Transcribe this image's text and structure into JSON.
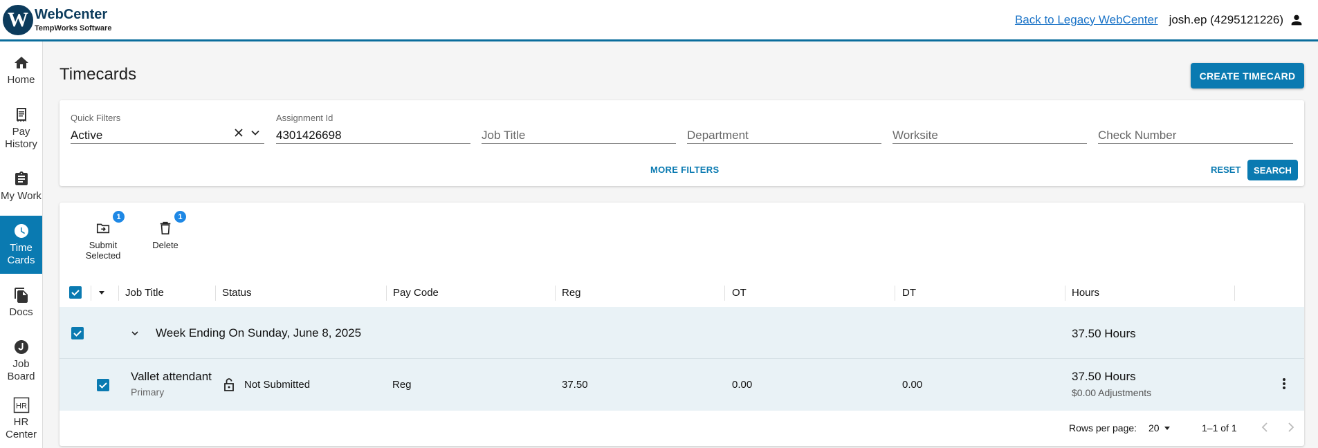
{
  "header": {
    "logo_letter": "W",
    "app_name": "WebCenter",
    "company": "TempWorks Software",
    "legacy_link": "Back to Legacy WebCenter",
    "user": "josh.ep (4295121226)"
  },
  "sidebar": {
    "items": [
      {
        "label": "Home",
        "icon": "home-icon"
      },
      {
        "label": "Pay History",
        "icon": "receipt-icon"
      },
      {
        "label": "My Work",
        "icon": "clipboard-icon"
      },
      {
        "label": "Time Cards",
        "icon": "clock-icon",
        "active": true
      },
      {
        "label": "Docs",
        "icon": "documents-icon"
      },
      {
        "label": "Job Board",
        "icon": "job-board-icon"
      },
      {
        "label": "HR Center",
        "icon": "hr-icon"
      }
    ]
  },
  "page": {
    "title": "Timecards",
    "create_button": "CREATE TIMECARD"
  },
  "filters": {
    "quick_filters_label": "Quick Filters",
    "quick_filters_value": "Active",
    "assignment_label": "Assignment Id",
    "assignment_value": "4301426698",
    "job_title_placeholder": "Job Title",
    "department_placeholder": "Department",
    "worksite_placeholder": "Worksite",
    "check_number_placeholder": "Check Number",
    "more_filters": "MORE FILTERS",
    "reset": "RESET",
    "search": "SEARCH"
  },
  "actions": {
    "submit_label": "Submit Selected",
    "submit_count": "1",
    "delete_label": "Delete",
    "delete_count": "1"
  },
  "table": {
    "columns": [
      "Job Title",
      "Status",
      "Pay Code",
      "Reg",
      "OT",
      "DT",
      "Hours"
    ],
    "group": {
      "title": "Week Ending On Sunday, June 8, 2025",
      "hours": "37.50 Hours"
    },
    "row": {
      "job_title": "Vallet attendant",
      "job_subtitle": "Primary",
      "status": "Not Submitted",
      "pay_code": "Reg",
      "reg": "37.50",
      "ot": "0.00",
      "dt": "0.00",
      "hours": "37.50 Hours",
      "adjustments": "$0.00 Adjustments"
    },
    "footer": {
      "rows_per_page_label": "Rows per page:",
      "rows_per_page_value": "20",
      "range": "1–1 of 1"
    }
  },
  "colors": {
    "primary": "#0a7ab1",
    "header_accent": "#0a6d9c",
    "row_highlight": "#e9f2f6",
    "badge": "#1e88e5"
  }
}
